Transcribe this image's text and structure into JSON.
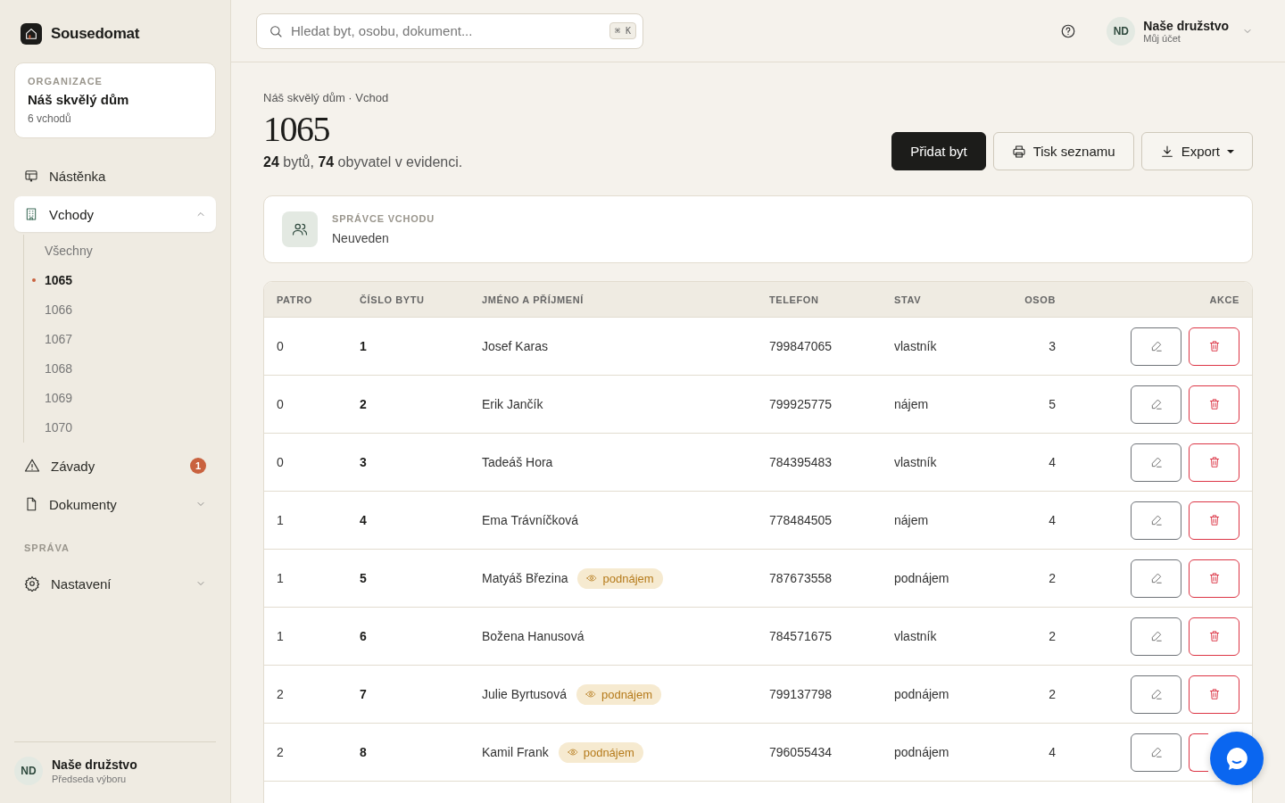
{
  "sidebar": {
    "brand": "Sousedomat",
    "organization": {
      "label": "ORGANIZACE",
      "name": "Náš skvělý dům",
      "detail": "6 vchodů"
    },
    "nav": [
      {
        "label": "Nástěnka",
        "selected": false
      },
      {
        "label": "Vchody",
        "selected": true,
        "expanded": true,
        "children": [
          {
            "label": "Všechny",
            "selected": false
          },
          {
            "label": "1065",
            "selected": true
          },
          {
            "label": "1066",
            "selected": false
          },
          {
            "label": "1067",
            "selected": false
          },
          {
            "label": "1068",
            "selected": false
          },
          {
            "label": "1069",
            "selected": false
          },
          {
            "label": "1070",
            "selected": false
          }
        ]
      },
      {
        "label": "Závady",
        "selected": false,
        "badge": "1"
      },
      {
        "label": "Dokumenty",
        "selected": false,
        "expanded": false
      }
    ],
    "section": "SPRÁVA",
    "admin_nav": [
      {
        "label": "Nastavení",
        "selected": false,
        "expanded": false
      }
    ],
    "user": {
      "initials": "ND",
      "name": "Naše družstvo",
      "role": "Předseda výboru"
    }
  },
  "topbar": {
    "search": {
      "placeholder": "Hledat byt, osobu, dokument...",
      "shortcut": "⌘ K"
    },
    "account": {
      "initials": "ND",
      "name": "Naše družstvo",
      "subtitle": "Můj účet"
    }
  },
  "header": {
    "breadcrumb": "Náš skvělý dům · Vchod",
    "title": "1065",
    "summary": "**24** bytů, **74** obyvatel v evidenci.",
    "buttons": [
      {
        "label": "Přidat byt",
        "kind": "primary"
      },
      {
        "label": "Tisk seznamu",
        "kind": "print"
      },
      {
        "label": "Export",
        "kind": "export"
      }
    ]
  },
  "manager": {
    "label": "SPRÁVCE VCHODU",
    "value": "Neuveden"
  },
  "table": {
    "columns": [
      "PATRO",
      "ČÍSLO BYTU",
      "JMÉNO A PŘÍJMENÍ",
      "TELEFON",
      "STAV",
      "OSOB",
      "AKCE"
    ],
    "rows": [
      {
        "floor": "0",
        "number": "1",
        "name": "Josef Karas",
        "phone": "799847065",
        "status": "vlastník",
        "persons": "3"
      },
      {
        "floor": "0",
        "number": "2",
        "name": "Erik Jančík",
        "phone": "799925775",
        "status": "nájem",
        "persons": "5"
      },
      {
        "floor": "0",
        "number": "3",
        "name": "Tadeáš Hora",
        "phone": "784395483",
        "status": "vlastník",
        "persons": "4"
      },
      {
        "floor": "1",
        "number": "4",
        "name": "Ema Trávníčková",
        "phone": "778484505",
        "status": "nájem",
        "persons": "4"
      },
      {
        "floor": "1",
        "number": "5",
        "name": "Matyáš Březina",
        "tag": "podnájem",
        "phone": "787673558",
        "status": "podnájem",
        "persons": "2"
      },
      {
        "floor": "1",
        "number": "6",
        "name": "Božena Hanusová",
        "phone": "784571675",
        "status": "vlastník",
        "persons": "2"
      },
      {
        "floor": "2",
        "number": "7",
        "name": "Julie Byrtusová",
        "tag": "podnájem",
        "phone": "799137798",
        "status": "podnájem",
        "persons": "2"
      },
      {
        "floor": "2",
        "number": "8",
        "name": "Kamil Frank",
        "tag": "podnájem",
        "phone": "796055434",
        "status": "podnájem",
        "persons": "4"
      }
    ]
  }
}
